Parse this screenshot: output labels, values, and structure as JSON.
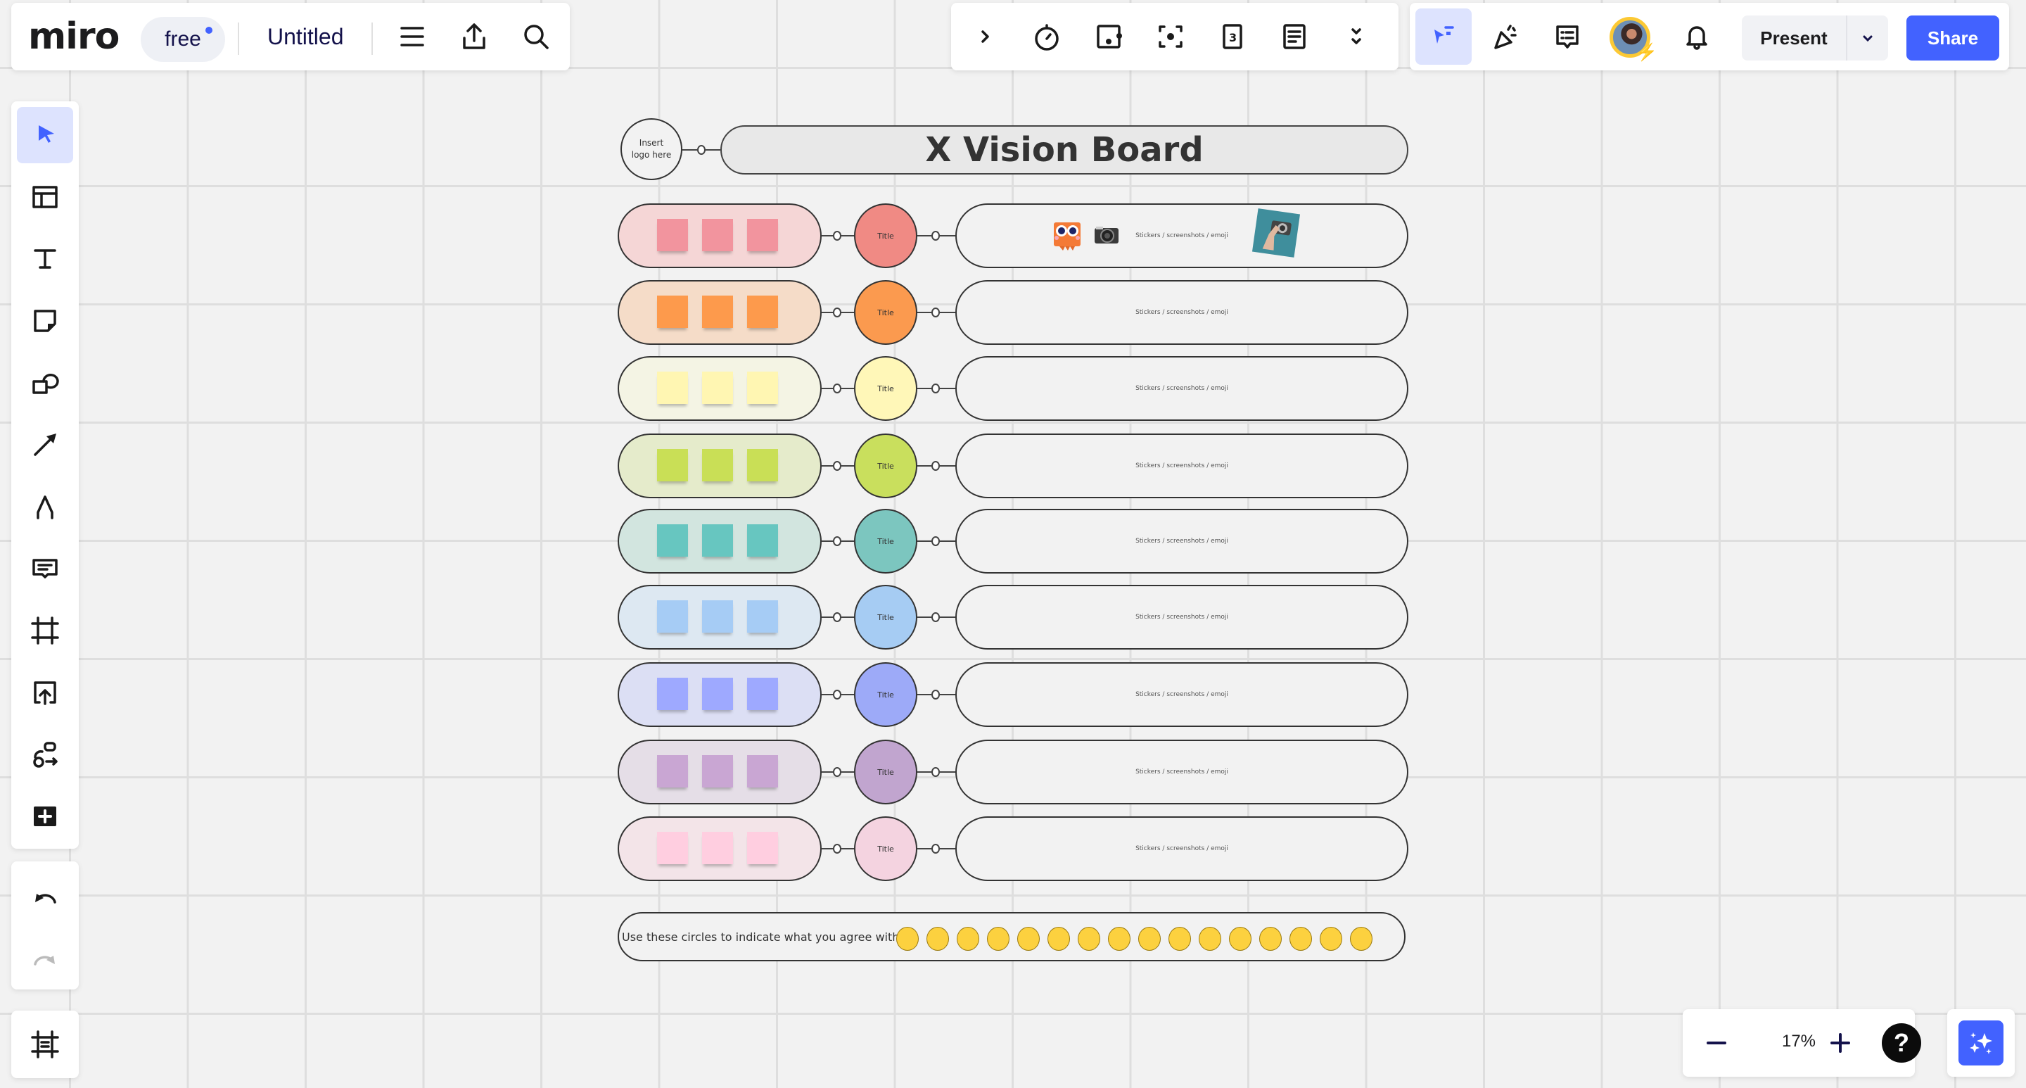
{
  "app": {
    "logo": "miro",
    "plan_badge": "free",
    "board_title": "Untitled"
  },
  "top_left_toolbar": {
    "menu_icon": "hamburger-menu-icon",
    "export_icon": "upload-icon",
    "search_icon": "search-icon"
  },
  "top_center_toolbar": {
    "icons": [
      "chevron-right-icon",
      "timer-icon",
      "voting-icon",
      "focus-icon",
      "card-icon",
      "notes-icon",
      "more-chevrons-icon"
    ]
  },
  "top_right_toolbar": {
    "icons": [
      "reactions-cursor-icon",
      "celebrate-icon",
      "comments-icon"
    ],
    "present_label": "Present",
    "share_label": "Share",
    "accent": "#4262ff"
  },
  "left_toolbar": {
    "tools": [
      "select",
      "templates",
      "text",
      "sticky-note",
      "shapes",
      "connection-line",
      "pen",
      "comment",
      "frame",
      "upload",
      "more-apps",
      "add"
    ],
    "active_tool": "select"
  },
  "history": {
    "undo": "undo",
    "redo": "redo"
  },
  "zoom": {
    "value": "17%"
  },
  "board": {
    "logo_placeholder": "Insert logo here",
    "title": "X Vision Board",
    "content_placeholder": "Stickers / screenshots / emoji",
    "rows": [
      {
        "title": "Title",
        "pill": "#f5d6d6",
        "sticky": "#f2949e",
        "circle": "#f08a84"
      },
      {
        "title": "Title",
        "pill": "#f5dcc8",
        "sticky": "#fd9a4c",
        "circle": "#fb9a4f"
      },
      {
        "title": "Title",
        "pill": "#f4f4e4",
        "sticky": "#fff6b2",
        "circle": "#fff7b8"
      },
      {
        "title": "Title",
        "pill": "#e5ebcb",
        "sticky": "#c9df56",
        "circle": "#c9df5d"
      },
      {
        "title": "Title",
        "pill": "#d2e5df",
        "sticky": "#67c6c0",
        "circle": "#7cc6bf"
      },
      {
        "title": "Title",
        "pill": "#dde8f2",
        "sticky": "#a6ccf5",
        "circle": "#a6ccf3"
      },
      {
        "title": "Title",
        "pill": "#dcdff4",
        "sticky": "#9ea9ff",
        "circle": "#9daaf8"
      },
      {
        "title": "Title",
        "pill": "#e5dee7",
        "sticky": "#c9a6d3",
        "circle": "#c1a5cf"
      },
      {
        "title": "Title",
        "pill": "#f3e4e8",
        "sticky": "#ffcee0",
        "circle": "#f4d3e0"
      }
    ],
    "agree_text": "Use these circles to indicate what you agree with",
    "agree_circles": 16
  }
}
